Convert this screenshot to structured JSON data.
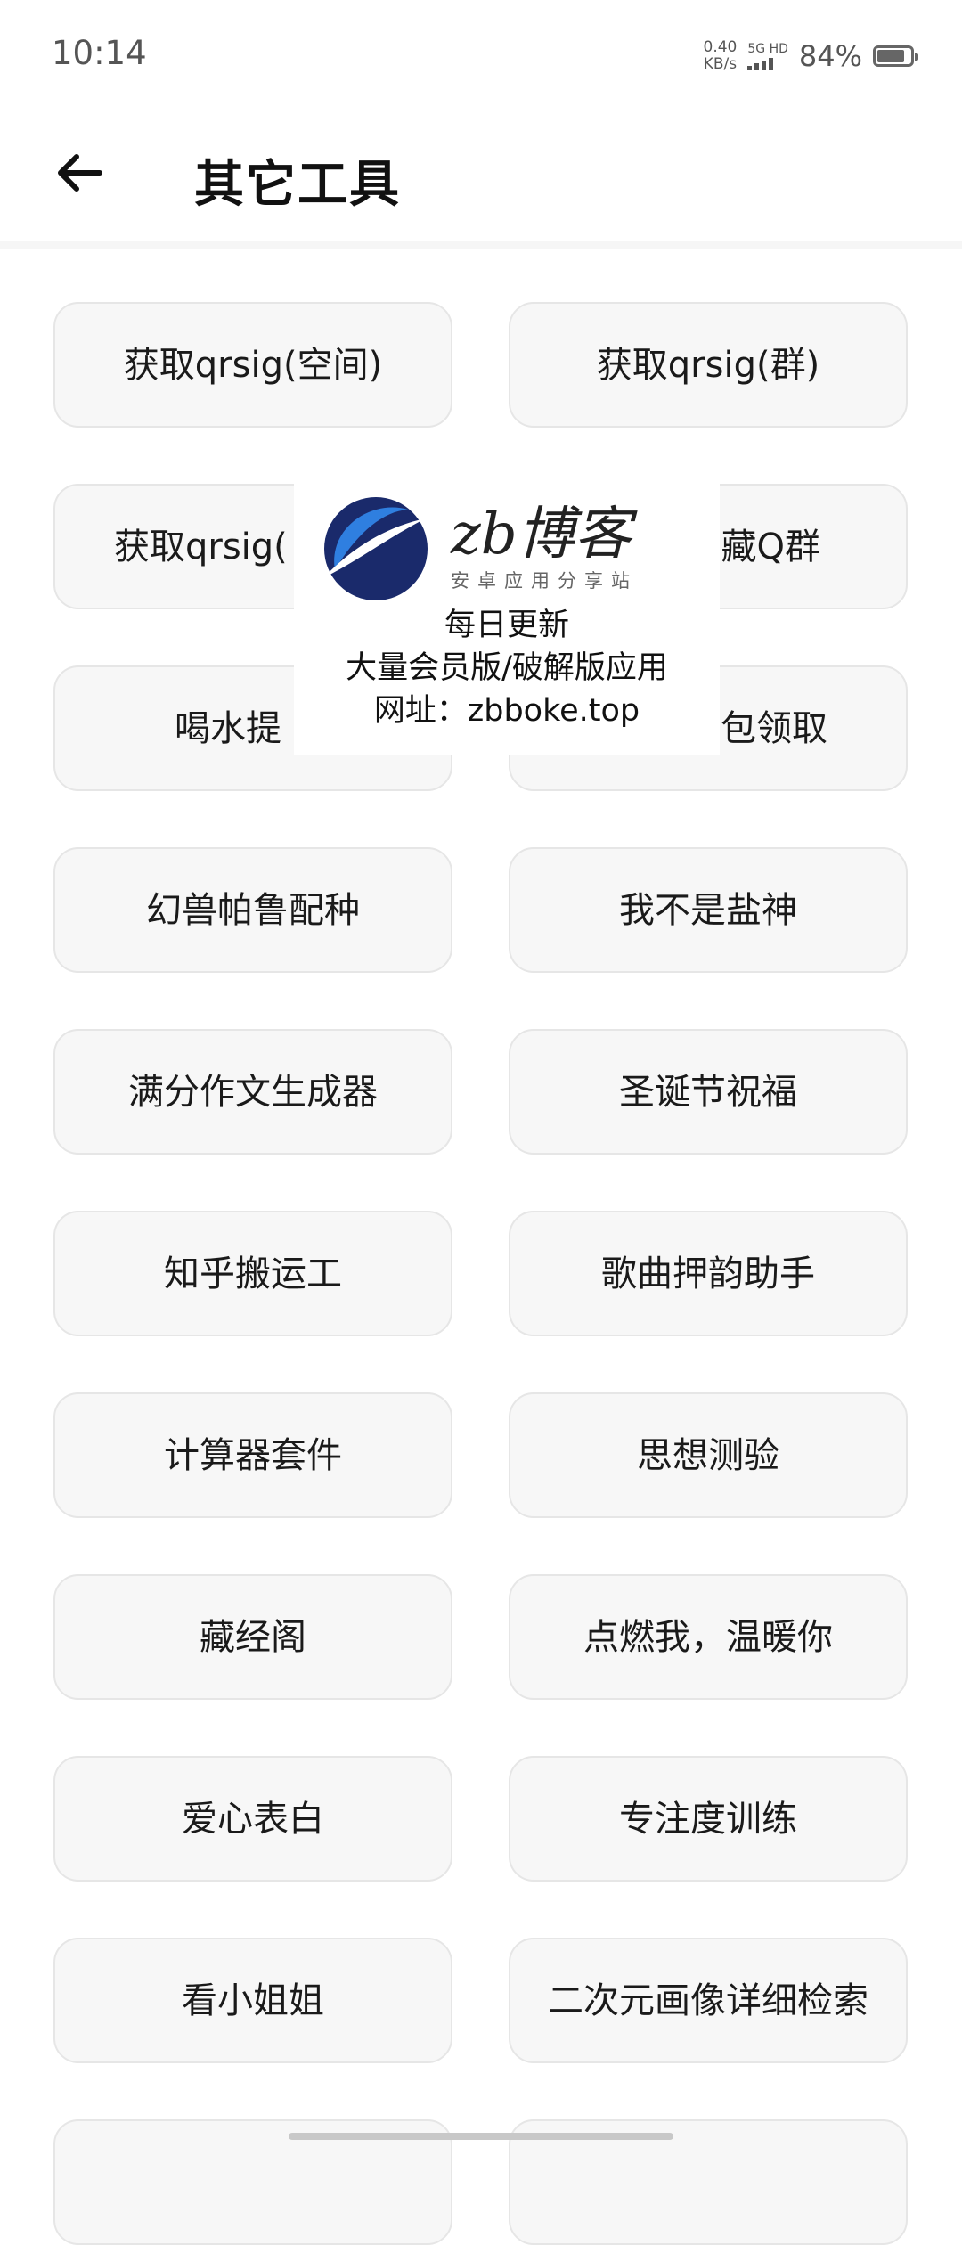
{
  "status_bar": {
    "time": "10:14",
    "net_speed_value": "0.40",
    "net_speed_unit": "KB/s",
    "net_type_top": "5G HD",
    "battery_percent": "84%",
    "battery_level": 0.84
  },
  "app_bar": {
    "back_icon": "arrow-left-icon",
    "title": "其它工具"
  },
  "tools": [
    {
      "label": "获取qrsig(空间)"
    },
    {
      "label": "获取qrsig(群)"
    },
    {
      "label": "获取qrsig("
    },
    {
      "label": "藏Q群"
    },
    {
      "label": "喝水提"
    },
    {
      "label": "包领取"
    },
    {
      "label": "幻兽帕鲁配种"
    },
    {
      "label": "我不是盐神"
    },
    {
      "label": "满分作文生成器"
    },
    {
      "label": "圣诞节祝福"
    },
    {
      "label": "知乎搬运工"
    },
    {
      "label": "歌曲押韵助手"
    },
    {
      "label": "计算器套件"
    },
    {
      "label": "思想测验"
    },
    {
      "label": "藏经阁"
    },
    {
      "label": "点燃我，温暖你"
    },
    {
      "label": "爱心表白"
    },
    {
      "label": "专注度训练"
    },
    {
      "label": "看小姐姐"
    },
    {
      "label": "二次元画像详细检索"
    }
  ],
  "watermark": {
    "brand": "zb博客",
    "subtitle": "安卓应用分享站",
    "line1": "每日更新",
    "line2": "大量会员版/破解版应用",
    "line3": "网址：zbboke.top"
  },
  "colors": {
    "button_bg": "#f7f7f7",
    "button_border": "#e6e6e6",
    "logo_blue": "#2f7fe0",
    "logo_navy": "#1a2a6b"
  }
}
